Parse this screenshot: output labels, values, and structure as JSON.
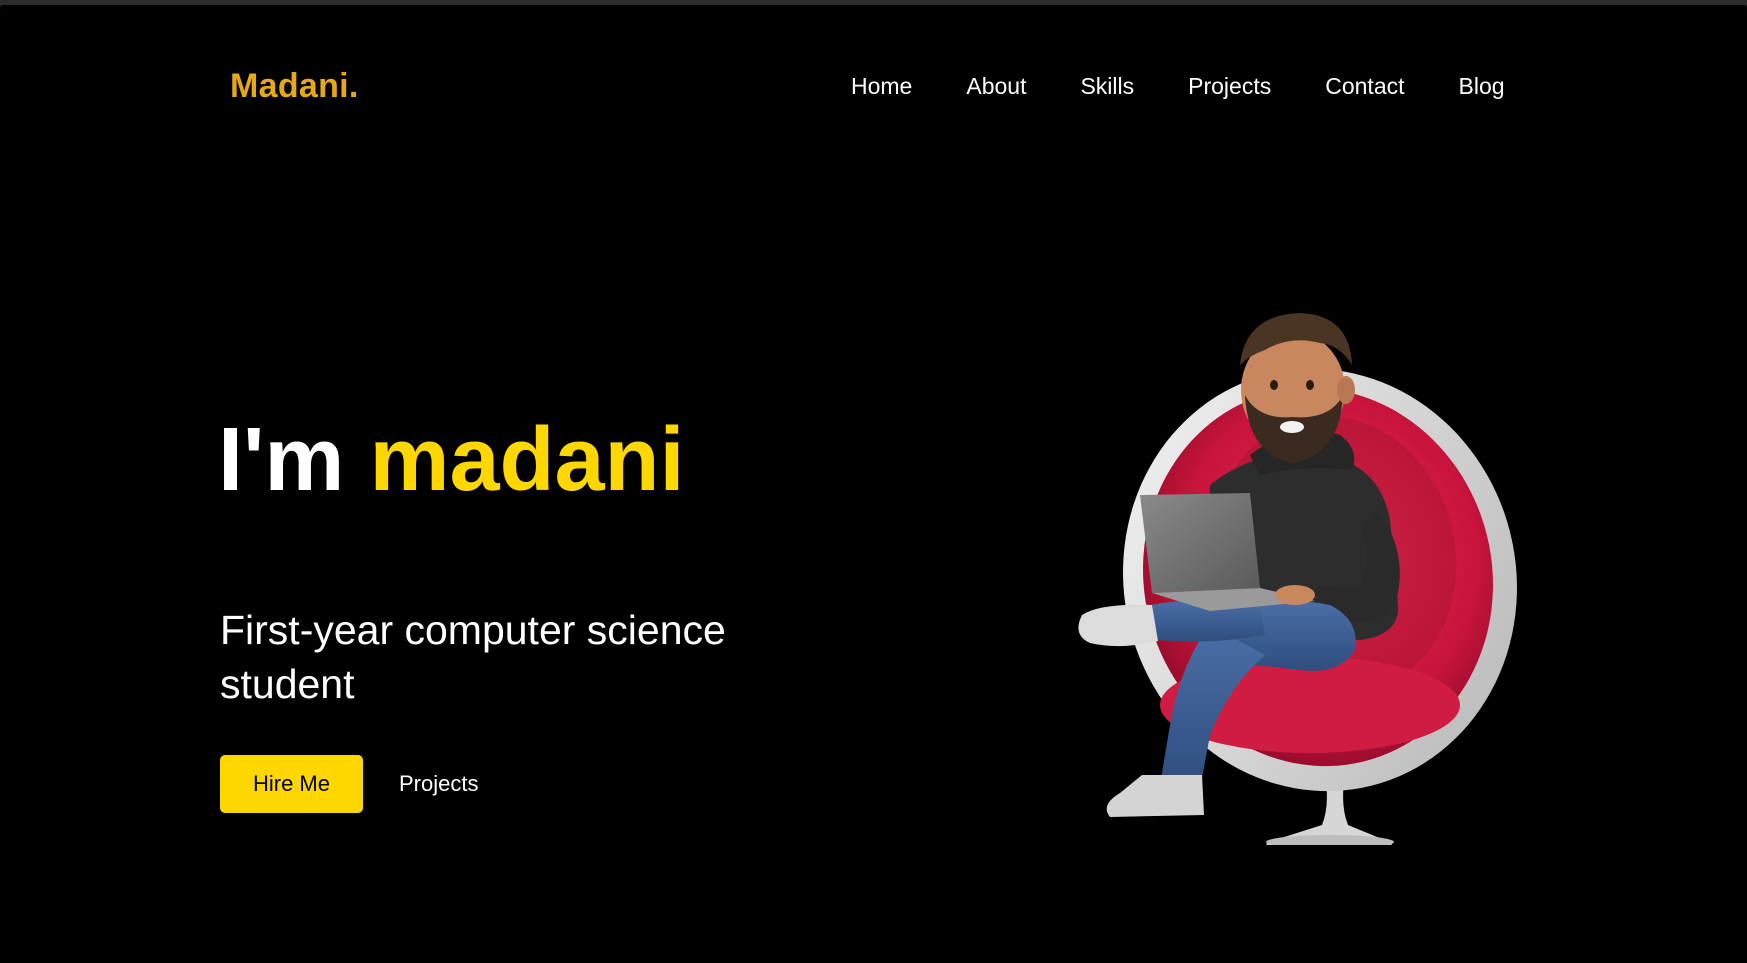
{
  "header": {
    "logo": "Madani.",
    "nav": [
      {
        "label": "Home"
      },
      {
        "label": "About"
      },
      {
        "label": "Skills"
      },
      {
        "label": "Projects"
      },
      {
        "label": "Contact"
      },
      {
        "label": "Blog"
      }
    ]
  },
  "hero": {
    "greeting": "I'm",
    "name": "madani",
    "subtitle": "First-year computer science student",
    "primary_button": "Hire Me",
    "secondary_button": "Projects",
    "illustration": "3d-avatar-man-with-laptop-in-egg-chair"
  },
  "colors": {
    "background": "#000000",
    "logo": "#e6a817",
    "accent": "#ffd700",
    "text": "#ffffff"
  }
}
